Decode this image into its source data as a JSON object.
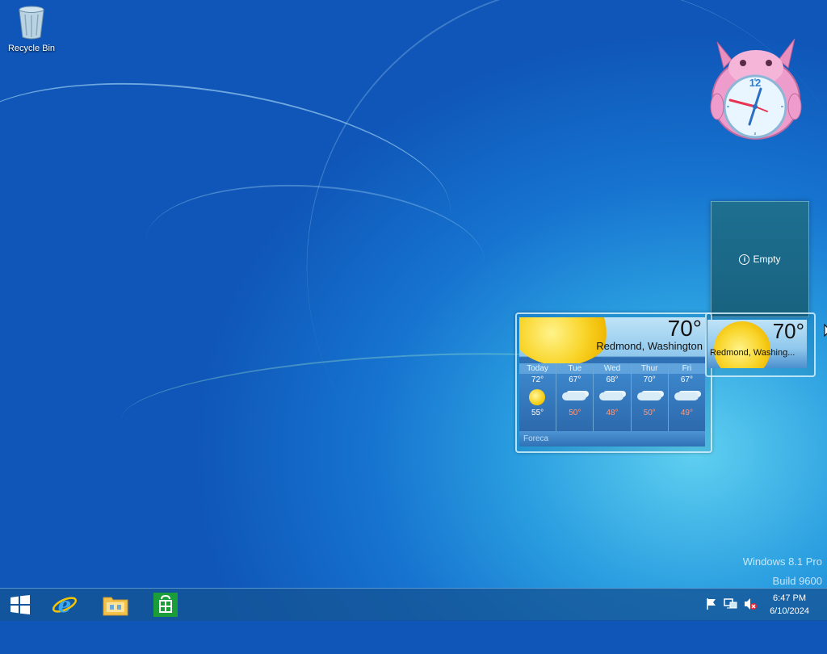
{
  "desktop": {
    "recycle_bin_label": "Recycle Bin"
  },
  "gadgets": {
    "clock": {
      "numeral": "12"
    },
    "empty_slot": {
      "label": "Empty"
    },
    "weather_large": {
      "temperature": "70°",
      "location": "Redmond, Washington",
      "forecast": [
        {
          "day": "Today",
          "high": "72°",
          "low": "55°",
          "icon": "sun-icon"
        },
        {
          "day": "Tue",
          "high": "67°",
          "low": "50°",
          "icon": "cloud-icon"
        },
        {
          "day": "Wed",
          "high": "68°",
          "low": "48°",
          "icon": "cloud-icon"
        },
        {
          "day": "Thur",
          "high": "70°",
          "low": "50°",
          "icon": "cloud-icon"
        },
        {
          "day": "Fri",
          "high": "67°",
          "low": "49°",
          "icon": "cloud-icon"
        }
      ],
      "provider": "Foreca"
    },
    "weather_small": {
      "temperature": "70°",
      "location": "Redmond, Washing..."
    }
  },
  "watermark": {
    "line1": "Windows 8.1 Pro",
    "line2": "Build 9600"
  },
  "taskbar": {
    "pinned": [
      "start-icon",
      "internet-explorer-icon",
      "file-explorer-icon",
      "store-icon"
    ],
    "tray": [
      "action-center-flag-icon",
      "network-icon",
      "volume-muted-icon"
    ],
    "time": "6:47 PM",
    "date": "6/10/2024"
  }
}
